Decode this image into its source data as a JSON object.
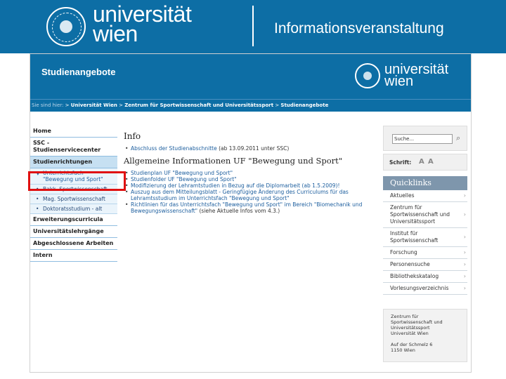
{
  "header": {
    "logo_line1": "universität",
    "logo_line2": "wien",
    "title": "Informationsveranstaltung"
  },
  "screenshot": {
    "banner": {
      "title": "Studienangebote",
      "logo_line1": "universität",
      "logo_line2": "wien"
    },
    "breadcrumb": {
      "prefix": "Sie sind hier:",
      "separator": ">",
      "items": [
        "Universität Wien",
        "Zentrum für Sportwissenschaft und Universitätssport",
        "Studienangebote"
      ]
    },
    "sidebar": {
      "items": [
        {
          "label": "Home"
        },
        {
          "label": "SSC - Studienservicecenter"
        },
        {
          "label": "Studienrichtungen"
        }
      ],
      "subitems": [
        {
          "bullet": "▼",
          "label": "Unterrichtsfach \"Bewegung und Sport\""
        },
        {
          "bullet": "•",
          "label": "Bakk. Sportwissenschaft"
        },
        {
          "bullet": "•",
          "label": "Mag. Sportwissenschaft"
        },
        {
          "bullet": "•",
          "label": "Doktoratsstudium - alt"
        }
      ],
      "items_after": [
        {
          "label": "Erweiterungscurricula"
        },
        {
          "label": "Universitätslehrgänge"
        },
        {
          "label": "Abgeschlossene Arbeiten"
        },
        {
          "label": "Intern"
        }
      ]
    },
    "main": {
      "info_heading": "Info",
      "info_link": "Abschluss der Studienabschnitte",
      "info_suffix": " (ab 13.09.2011 unter SSC)",
      "section_heading": "Allgemeine Informationen UF \"Bewegung und Sport\"",
      "links": [
        {
          "label": "Studienplan UF \"Bewegung und Sport\"",
          "suffix": ""
        },
        {
          "label": "Studienfolder UF \"Bewegung und Sport\"",
          "suffix": ""
        },
        {
          "label": "Modifizierung der Lehramtstudien in Bezug auf die Diplomarbeit (ab 1.5.2009)!",
          "suffix": ""
        },
        {
          "label": "Auszug aus dem Mitteilungsblatt - Geringfügige Änderung des Curriculums für das Lehramtsstudium im Unterrichtsfach \"Bewegung und Sport\"",
          "suffix": ""
        },
        {
          "label": "Richtlinien für das Unterrichtsfach \"Bewegung und Sport\" im Bereich \"Biomechanik und Bewegungswissenschaft\"",
          "suffix": " (siehe Aktuelle Infos vom 4.3.)"
        }
      ]
    },
    "right": {
      "search_value": "Suche...",
      "font_label": "Schrift:",
      "quicklinks_title": "Quicklinks",
      "quicklinks": [
        {
          "label": "Aktuelles"
        },
        {
          "label": "Zentrum für Sportwissenschaft und Universitätssport"
        },
        {
          "label": "Institut für Sportwissenschaft"
        },
        {
          "label": "Forschung"
        },
        {
          "label": "Personensuche"
        },
        {
          "label": "Bibliothekskatalog"
        },
        {
          "label": "Vorlesungsverzeichnis"
        }
      ],
      "address_lines": [
        "Zentrum für",
        "Sportwissenschaft und",
        "Universitätssport",
        "Universität Wien",
        "",
        "Auf der Schmelz 6",
        "1150 Wien"
      ]
    }
  },
  "colors": {
    "brand_blue": "#0d6ea5",
    "highlight_red": "#e01010",
    "quicklinks_header": "#7e96ac"
  }
}
